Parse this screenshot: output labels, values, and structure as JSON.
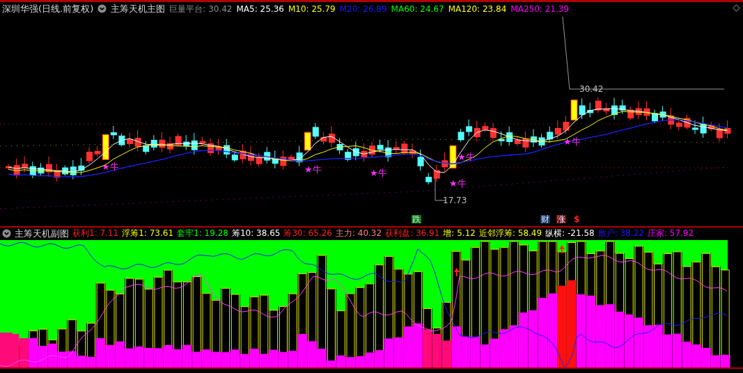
{
  "window": {
    "title": "深圳华强(日线.前复权)"
  },
  "main_chart": {
    "name": "主筹天机主图",
    "indicators": [
      {
        "label": "巨量平台: 30.42",
        "color": "#8c8c8c"
      },
      {
        "label": "MA5: 25.36",
        "color": "#ffffff"
      },
      {
        "label": "M10: 25.79",
        "color": "#ffff00"
      },
      {
        "label": "M20: 26.89",
        "color": "#1a1aff"
      },
      {
        "label": "MA60: 24.67",
        "color": "#00ff00"
      },
      {
        "label": "MA120: 23.84",
        "color": "#ffff00"
      },
      {
        "label": "MA250: 21.39",
        "color": "#ff00ff"
      }
    ],
    "price_labels": {
      "high": "30.42",
      "low": "17.73"
    },
    "signals": [
      "★牛",
      "★牛",
      "★牛",
      "★牛",
      "★牛",
      "★牛"
    ],
    "markers": [
      {
        "text": "跌",
        "kind": "box",
        "color": "#0a7a0a"
      },
      {
        "text": "财",
        "kind": "box",
        "color": "#123a66"
      },
      {
        "text": "涨",
        "kind": "box",
        "color": "#7a0a0a"
      },
      {
        "text": "$",
        "kind": "plain",
        "color": "#ff2020"
      }
    ]
  },
  "sub_chart": {
    "name": "主筹天机副图",
    "indicators": [
      {
        "label": "获利1: 7.11",
        "color": "#ff2020"
      },
      {
        "label": "浮筹1: 73.61",
        "color": "#ffff00"
      },
      {
        "label": "套牢1: 19.28",
        "color": "#00ff00"
      },
      {
        "label": "筹10: 38.65",
        "color": "#ffffff"
      },
      {
        "label": "筹30: 65.26",
        "color": "#ff2020"
      },
      {
        "label": "主力: 40.32",
        "color": "#ff8080"
      },
      {
        "label": "获利盘: 36.91",
        "color": "#ff2020"
      },
      {
        "label": "增: 5.12",
        "color": "#ffff00"
      },
      {
        "label": "近邻浮筹: 58.49",
        "color": "#ffff00"
      },
      {
        "label": "纵横: -21.58",
        "color": "#ffffff"
      },
      {
        "label": "散户: 38.22",
        "color": "#1a1aff"
      },
      {
        "label": "庄家: 57.92",
        "color": "#ff00ff"
      }
    ]
  }
}
